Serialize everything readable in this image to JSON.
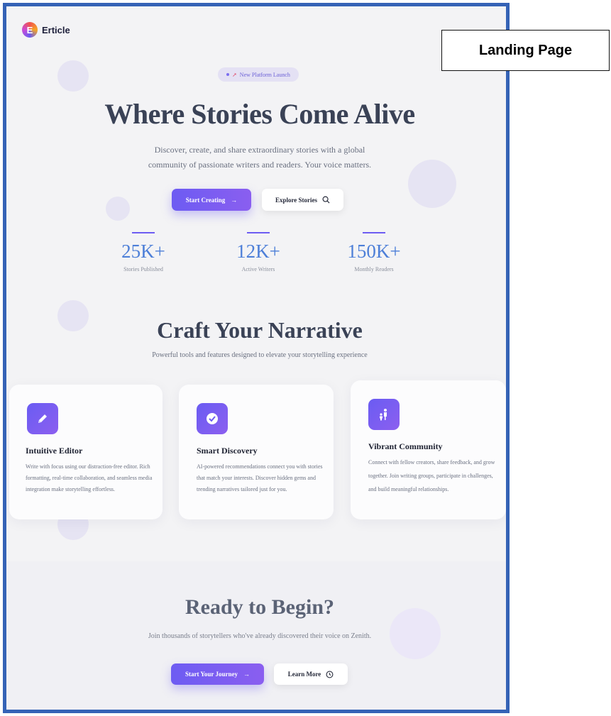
{
  "brand": {
    "name": "Erticle",
    "logo_letter": "E"
  },
  "annotation": {
    "label": "Landing Page"
  },
  "hero": {
    "badge": "New Platform Launch",
    "title": "Where Stories Come Alive",
    "subtitle": "Discover, create, and share extraordinary stories with a global community of passionate writers and readers. Your voice matters.",
    "primary_button": "Start Creating",
    "secondary_button": "Explore Stories"
  },
  "stats": [
    {
      "value": "25K+",
      "label": "Stories Published"
    },
    {
      "value": "12K+",
      "label": "Active Writers"
    },
    {
      "value": "150K+",
      "label": "Monthly Readers"
    }
  ],
  "features": {
    "title": "Craft Your Narrative",
    "subtitle": "Powerful tools and features designed to elevate your storytelling experience",
    "cards": [
      {
        "icon": "pencil-icon",
        "title": "Intuitive Editor",
        "description": "Write with focus using our distraction-free editor. Rich formatting, real-time collaboration, and seamless media integration make storytelling effortless."
      },
      {
        "icon": "check-circle-icon",
        "title": "Smart Discovery",
        "description": "AI-powered recommendations connect you with stories that match your interests. Discover hidden gems and trending narratives tailored just for you."
      },
      {
        "icon": "community-icon",
        "title": "Vibrant Community",
        "description": "Connect with fellow creators, share feedback, and grow together. Join writing groups, participate in challenges, and build meaningful relationships."
      }
    ]
  },
  "cta": {
    "title": "Ready to Begin?",
    "subtitle": "Join thousands of storytellers who've already discovered their voice on Zenith.",
    "primary_button": "Start Your Journey",
    "secondary_button": "Learn More"
  },
  "colors": {
    "accent": "#6d5cf2",
    "stat": "#4d7fd8",
    "heading": "#3a4256",
    "frame": "#3563b6"
  }
}
